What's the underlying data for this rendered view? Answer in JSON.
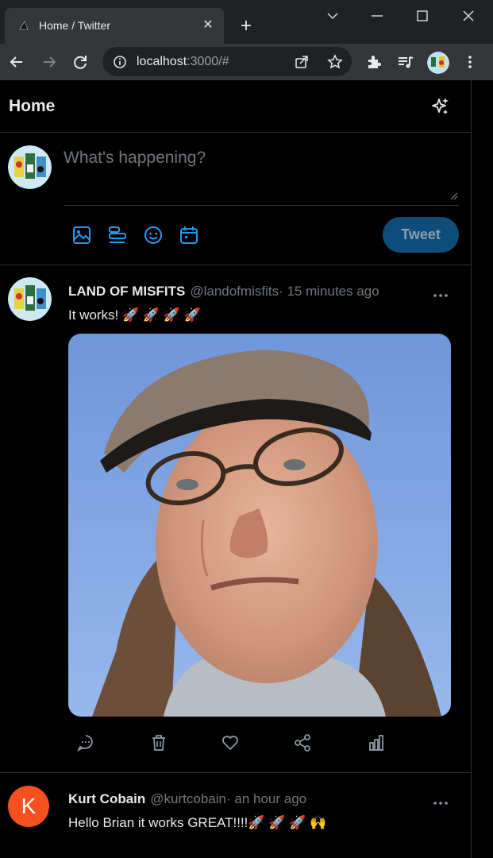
{
  "browser": {
    "tab_title": "Home / Twitter",
    "url_host": "localhost",
    "url_rest": ":3000/#",
    "icons": [
      "back-icon",
      "forward-icon",
      "reload-icon",
      "info-icon",
      "share-icon",
      "star-icon",
      "extensions-icon",
      "media-icon",
      "profile-avatar",
      "kebab-menu-icon"
    ]
  },
  "header": {
    "title": "Home"
  },
  "composer": {
    "placeholder": "What's happening?",
    "tweet_label": "Tweet",
    "tools": [
      "image-icon",
      "poll-icon",
      "emoji-icon",
      "schedule-icon"
    ]
  },
  "tweets": [
    {
      "name": "LAND OF MISFITS",
      "handle": "@landofmisfits",
      "time": "· 15 minutes ago",
      "text": "It works! 🚀 🚀 🚀 🚀",
      "has_photo": true,
      "actions": [
        "reply-icon",
        "delete-icon",
        "like-icon",
        "share-icon",
        "analytics-icon"
      ]
    },
    {
      "name": "Kurt Cobain",
      "handle": "@kurtcobain",
      "time": "· an hour ago",
      "text": "Hello Brian it works GREAT!!!!🚀 🚀 🚀 🙌",
      "avatar_letter": "K"
    }
  ],
  "colors": {
    "accent": "#1d9bf0",
    "tweet_button_bg": "#0e4d7a",
    "kurt_avatar": "#f4511e",
    "border": "#2f3336",
    "muted_text": "#71767b"
  }
}
